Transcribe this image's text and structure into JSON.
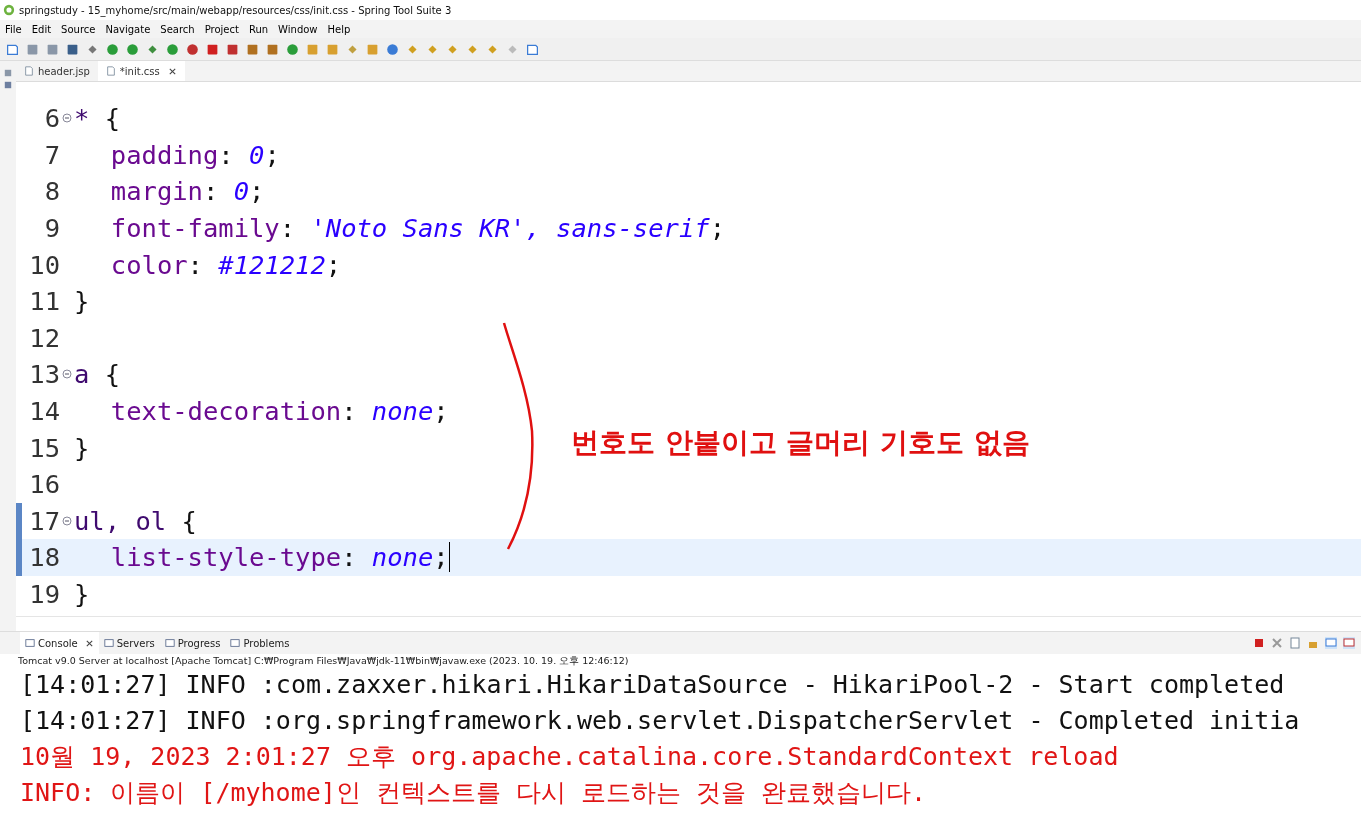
{
  "window": {
    "title": "springstudy - 15_myhome/src/main/webapp/resources/css/init.css - Spring Tool Suite 3"
  },
  "menu": [
    "File",
    "Edit",
    "Source",
    "Navigate",
    "Search",
    "Project",
    "Run",
    "Window",
    "Help"
  ],
  "editor_tabs": [
    {
      "label": "header.jsp",
      "selected": false,
      "closable": false
    },
    {
      "label": "*init.css",
      "selected": true,
      "closable": true
    }
  ],
  "code_lines": [
    {
      "number": "6",
      "indented": false,
      "foldable": true,
      "changed": false,
      "current": false,
      "cursor": false,
      "tokens": [
        {
          "kind": "selector",
          "text": "*"
        },
        {
          "kind": "plain",
          "text": " {"
        }
      ]
    },
    {
      "number": "7",
      "indented": true,
      "foldable": false,
      "changed": false,
      "current": false,
      "cursor": false,
      "tokens": [
        {
          "kind": "property",
          "text": "padding"
        },
        {
          "kind": "plain",
          "text": ": "
        },
        {
          "kind": "value",
          "text": "0"
        },
        {
          "kind": "plain",
          "text": ";"
        }
      ]
    },
    {
      "number": "8",
      "indented": true,
      "foldable": false,
      "changed": false,
      "current": false,
      "cursor": false,
      "tokens": [
        {
          "kind": "property",
          "text": "margin"
        },
        {
          "kind": "plain",
          "text": ": "
        },
        {
          "kind": "value",
          "text": "0"
        },
        {
          "kind": "plain",
          "text": ";"
        }
      ]
    },
    {
      "number": "9",
      "indented": true,
      "foldable": false,
      "changed": false,
      "current": false,
      "cursor": false,
      "tokens": [
        {
          "kind": "property",
          "text": "font-family"
        },
        {
          "kind": "plain",
          "text": ": "
        },
        {
          "kind": "value",
          "text": "'Noto Sans KR', sans-serif"
        },
        {
          "kind": "plain",
          "text": ";"
        }
      ]
    },
    {
      "number": "10",
      "indented": true,
      "foldable": false,
      "changed": false,
      "current": false,
      "cursor": false,
      "tokens": [
        {
          "kind": "property",
          "text": "color"
        },
        {
          "kind": "plain",
          "text": ": "
        },
        {
          "kind": "value",
          "text": "#121212"
        },
        {
          "kind": "plain",
          "text": ";"
        }
      ]
    },
    {
      "number": "11",
      "indented": false,
      "foldable": false,
      "changed": false,
      "current": false,
      "cursor": false,
      "tokens": [
        {
          "kind": "plain",
          "text": "}"
        }
      ]
    },
    {
      "number": "12",
      "foldable": false,
      "changed": false,
      "current": false,
      "cursor": false
    },
    {
      "number": "13",
      "indented": false,
      "foldable": true,
      "changed": false,
      "current": false,
      "cursor": false,
      "tokens": [
        {
          "kind": "selector",
          "text": "a"
        },
        {
          "kind": "plain",
          "text": " {"
        }
      ]
    },
    {
      "number": "14",
      "indented": true,
      "foldable": false,
      "changed": false,
      "current": false,
      "cursor": false,
      "tokens": [
        {
          "kind": "property",
          "text": "text-decoration"
        },
        {
          "kind": "plain",
          "text": ": "
        },
        {
          "kind": "value",
          "text": "none"
        },
        {
          "kind": "plain",
          "text": ";"
        }
      ]
    },
    {
      "number": "15",
      "indented": false,
      "foldable": false,
      "changed": false,
      "current": false,
      "cursor": false,
      "tokens": [
        {
          "kind": "plain",
          "text": "}"
        }
      ]
    },
    {
      "number": "16",
      "foldable": false,
      "changed": false,
      "current": false,
      "cursor": false
    },
    {
      "number": "17",
      "indented": false,
      "foldable": true,
      "changed": true,
      "current": false,
      "cursor": false,
      "tokens": [
        {
          "kind": "selector",
          "text": "ul, ol"
        },
        {
          "kind": "plain",
          "text": " {"
        }
      ]
    },
    {
      "number": "18",
      "indented": true,
      "foldable": false,
      "changed": true,
      "current": true,
      "cursor": true,
      "tokens": [
        {
          "kind": "property",
          "text": "list-style-type"
        },
        {
          "kind": "plain",
          "text": ": "
        },
        {
          "kind": "value",
          "text": "none"
        },
        {
          "kind": "plain",
          "text": ";"
        }
      ]
    },
    {
      "number": "19",
      "indented": false,
      "foldable": false,
      "changed": false,
      "current": false,
      "cursor": false,
      "tokens": [
        {
          "kind": "plain",
          "text": "}"
        }
      ]
    }
  ],
  "annotation": {
    "text": "번호도 안붙이고 글머리 기호도 없음"
  },
  "console_tabs": [
    {
      "label": "Console",
      "selected": true,
      "closable": true
    },
    {
      "label": "Servers",
      "selected": false,
      "closable": false
    },
    {
      "label": "Progress",
      "selected": false,
      "closable": false
    },
    {
      "label": "Problems",
      "selected": false,
      "closable": false
    }
  ],
  "console_header": "Tomcat v9.0 Server at localhost [Apache Tomcat] C:₩Program Files₩Java₩jdk-11₩bin₩javaw.exe  (2023. 10. 19. 오후 12:46:12)",
  "console_lines": [
    {
      "kind": "stdout",
      "text": "[14:01:27] INFO :com.zaxxer.hikari.HikariDataSource - HikariPool-2 - Start completed"
    },
    {
      "kind": "stdout",
      "text": "[14:01:27] INFO :org.springframework.web.servlet.DispatcherServlet - Completed initia"
    },
    {
      "kind": "stderr",
      "text": "10월 19, 2023 2:01:27 오후 org.apache.catalina.core.StandardContext reload"
    },
    {
      "kind": "stderr",
      "text": "INFO: 이름이 [/myhome]인 컨텍스트를 다시 로드하는 것을 완료했습니다."
    }
  ]
}
